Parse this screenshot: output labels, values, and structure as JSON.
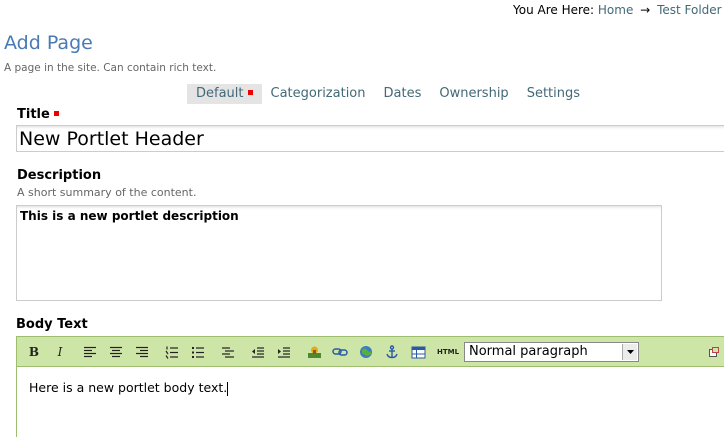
{
  "breadcrumb": {
    "prefix": "You Are Here:",
    "items": [
      "Home",
      "Test Folder"
    ],
    "separator": "→"
  },
  "page": {
    "title": "Add Page",
    "description": "A page in the site. Can contain rich text."
  },
  "tabs": [
    {
      "label": "Default",
      "active": true
    },
    {
      "label": "Categorization",
      "active": false
    },
    {
      "label": "Dates",
      "active": false
    },
    {
      "label": "Ownership",
      "active": false
    },
    {
      "label": "Settings",
      "active": false
    }
  ],
  "fields": {
    "title": {
      "label": "Title",
      "value": "New Portlet Header",
      "required": true
    },
    "description": {
      "label": "Description",
      "help": "A short summary of the content.",
      "value": "This is a new portlet description"
    },
    "body": {
      "label": "Body Text",
      "value": "Here is a new portlet body text."
    }
  },
  "editor": {
    "format_value": "Normal paragraph",
    "html_label": "HTML",
    "toolbar_icons": [
      "bold-icon",
      "italic-icon",
      "align-left-icon",
      "align-center-icon",
      "align-right-icon",
      "ordered-list-icon",
      "unordered-list-icon",
      "definition-list-icon",
      "outdent-icon",
      "indent-icon",
      "insert-image-icon",
      "insert-link-icon",
      "insert-external-link-icon",
      "insert-anchor-icon",
      "insert-table-icon",
      "html-source-icon"
    ]
  },
  "colors": {
    "accent_blue": "#4a7ab5",
    "link": "#436976",
    "toolbar_bg": "#cde6a7",
    "required": "#ee0000"
  }
}
